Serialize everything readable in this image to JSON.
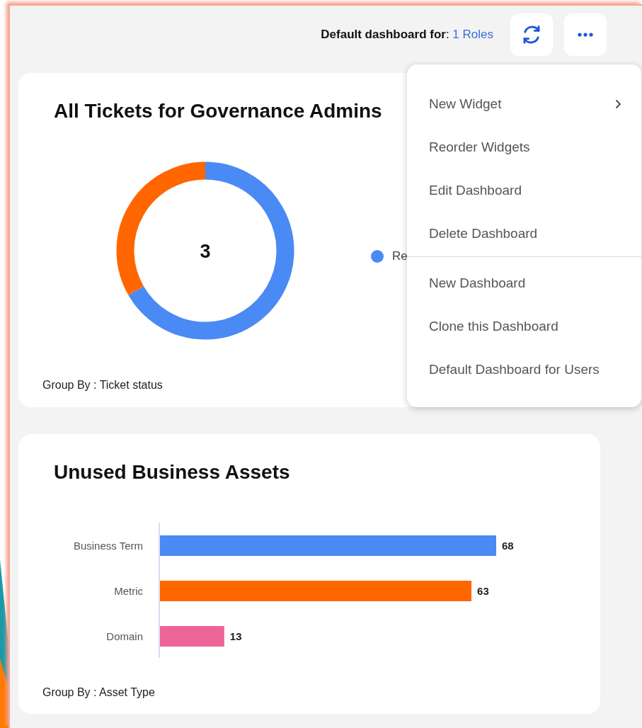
{
  "header": {
    "label": "Default dashboard for",
    "separator": ": ",
    "roles_link": "1 Roles"
  },
  "tickets_widget": {
    "title": "All Tickets for Governance Admins",
    "total": "3",
    "legend": [
      {
        "label": "Re",
        "color": "#4a8af4"
      }
    ],
    "group_by": "Group By : Ticket status"
  },
  "assets_widget": {
    "title": "Unused Business Assets",
    "chart_data": {
      "type": "bar",
      "orientation": "horizontal",
      "categories": [
        "Business Term",
        "Metric",
        "Domain"
      ],
      "series": [
        {
          "values": [
            68,
            63,
            13
          ]
        }
      ],
      "colors": [
        "#4a8af4",
        "#ff6600",
        "#ec6597"
      ],
      "data_labels": true
    },
    "group_by": "Group By : Asset Type"
  },
  "menu": {
    "sections": [
      [
        {
          "label": "New Widget",
          "submenu": true
        },
        {
          "label": "Reorder Widgets",
          "submenu": false
        },
        {
          "label": "Edit Dashboard",
          "submenu": false
        },
        {
          "label": "Delete Dashboard",
          "submenu": false
        }
      ],
      [
        {
          "label": "New Dashboard",
          "submenu": false
        },
        {
          "label": "Clone this Dashboard",
          "submenu": false
        },
        {
          "label": "Default Dashboard for Users",
          "submenu": false
        }
      ]
    ]
  }
}
